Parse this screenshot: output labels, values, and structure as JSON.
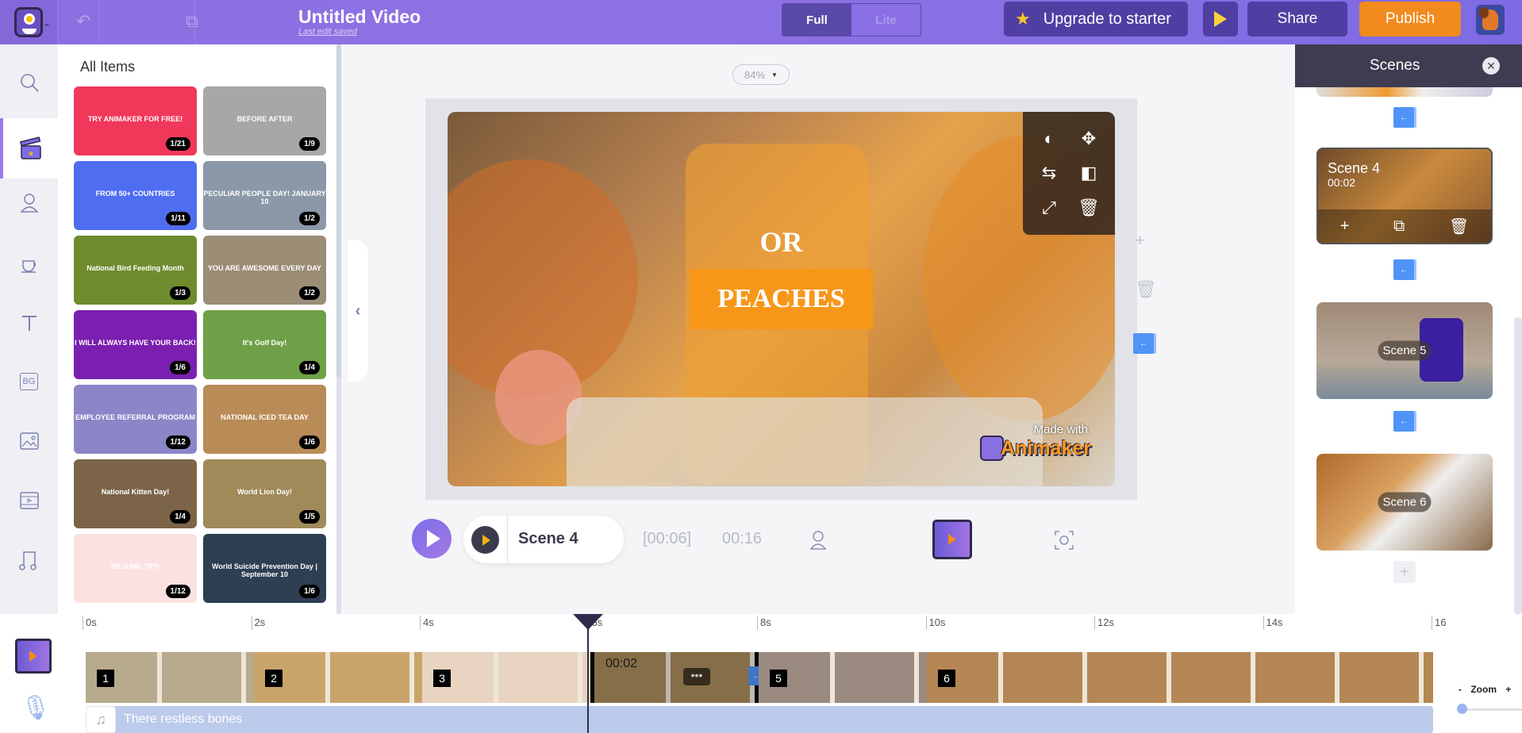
{
  "header": {
    "title": "Untitled Video",
    "subtitle": "Last edit saved",
    "mode_full": "Full",
    "mode_lite": "Lite",
    "upgrade_label": "Upgrade to starter",
    "share_label": "Share",
    "publish_label": "Publish"
  },
  "rail": {
    "items": [
      "search",
      "templates",
      "characters",
      "props",
      "text",
      "backgrounds",
      "images",
      "videos",
      "music"
    ],
    "bg_label": "BG"
  },
  "library": {
    "title": "All Items",
    "cards": [
      {
        "label": "TRY ANIMAKER FOR FREE!",
        "count": "1/21",
        "color": "#f0385a"
      },
      {
        "label": "BEFORE   AFTER",
        "count": "1/9",
        "color": "#a9a7a5"
      },
      {
        "label": "FROM 50+ COUNTRIES",
        "count": "1/11",
        "color": "#4f6df0"
      },
      {
        "label": "PECULIAR PEOPLE DAY! JANUARY 10",
        "count": "1/2",
        "color": "#8a98a8"
      },
      {
        "label": "National Bird Feeding Month",
        "count": "1/3",
        "color": "#6e8c2e"
      },
      {
        "label": "YOU ARE AWESOME EVERY DAY",
        "count": "1/2",
        "color": "#9b8d76"
      },
      {
        "label": "I WILL ALWAYS HAVE YOUR BACK!",
        "count": "1/6",
        "color": "#7a1fb0"
      },
      {
        "label": "It's Golf Day!",
        "count": "1/4",
        "color": "#6fa048"
      },
      {
        "label": "EMPLOYEE REFERRAL PROGRAM",
        "count": "1/12",
        "color": "#8a86c8"
      },
      {
        "label": "NATIONAL ICED TEA DAY",
        "count": "1/6",
        "color": "#b98b56"
      },
      {
        "label": "National Kitten Day!",
        "count": "1/4",
        "color": "#7b6448"
      },
      {
        "label": "World Lion Day!",
        "count": "1/5",
        "color": "#a08a5a"
      },
      {
        "label": "RESUME TIPS",
        "count": "1/12",
        "color": "#fbe1e1"
      },
      {
        "label": "World Suicide Prevention Day | September 10",
        "count": "1/6",
        "color": "#2e3f52"
      }
    ]
  },
  "stage": {
    "zoom": "84%",
    "text_or": "OR",
    "text_peaches": "PEACHES",
    "made_with": "Made with",
    "brand": "Animaker",
    "accent": "#f7971a"
  },
  "player": {
    "scene_label": "Scene 4",
    "current_time": "[00:06]",
    "total_time": "00:16"
  },
  "scenes_panel": {
    "title": "Scenes",
    "scenes": [
      {
        "label": "Scene 4",
        "duration": "00:02",
        "active": true
      },
      {
        "label": "Scene 5"
      },
      {
        "label": "Scene 6"
      }
    ]
  },
  "timeline": {
    "ticks": [
      "0s",
      "2s",
      "4s",
      "6s",
      "8s",
      "10s",
      "12s",
      "14s",
      "16"
    ],
    "segments": [
      {
        "num": "1",
        "color": "#b8aa8c"
      },
      {
        "num": "2",
        "color": "#c9a46a"
      },
      {
        "num": "3",
        "color": "#e8d4c0"
      },
      {
        "num": "",
        "duration": "00:02",
        "color": "#a88a5a"
      },
      {
        "num": "5",
        "color": "#9a8a80"
      },
      {
        "num": "6",
        "color": "#b48654"
      }
    ],
    "audio_track": "There restless bones",
    "zoom_label": "Zoom",
    "zoom_minus": "-",
    "zoom_plus": "+",
    "zoom_level": 0
  }
}
